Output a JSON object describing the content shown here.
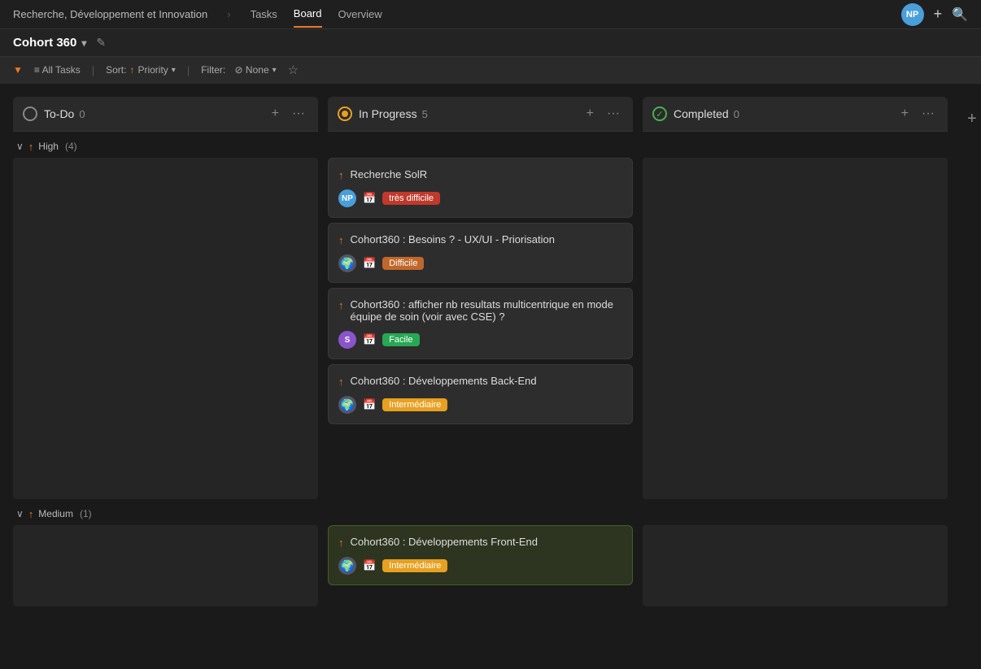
{
  "nav": {
    "breadcrumb": "Recherche, Développement et Innovation",
    "tabs": [
      "Tasks",
      "Board",
      "Overview"
    ],
    "active_tab": "Board",
    "top_right": {
      "avatar": "NP",
      "plus": "+",
      "search": "🔍"
    }
  },
  "toolbar": {
    "project_name": "Cohort 360",
    "dropdown_arrow": "▾",
    "edit_icon": "✎"
  },
  "filters": {
    "filter_label": "▼",
    "all_tasks": "≡ All Tasks",
    "sort_label": "Sort:",
    "sort_icon": "↑",
    "sort_value": "Priority",
    "filter_label2": "Filter:",
    "filter_none": "⊘ None",
    "star": "☆"
  },
  "columns": [
    {
      "id": "todo",
      "title": "To-Do",
      "count": 0,
      "status_type": "empty"
    },
    {
      "id": "inprogress",
      "title": "In Progress",
      "count": 5,
      "status_type": "progress"
    },
    {
      "id": "completed",
      "title": "Completed",
      "count": 0,
      "status_type": "done"
    }
  ],
  "groups": [
    {
      "id": "high",
      "label": "High",
      "count": 4,
      "cards": {
        "todo": [],
        "inprogress": [
          {
            "title": "Recherche SolR",
            "avatar": {
              "text": "NP",
              "color": "#4a9eda"
            },
            "tag": "très difficile",
            "tag_color": "tag-red"
          },
          {
            "title": "Cohort360 : Besoins ? - UX/UI - Priorisation",
            "avatar": {
              "text": "🌍",
              "color": "#556"
            },
            "tag": "Difficile",
            "tag_color": "tag-orange"
          },
          {
            "title": "Cohort360 : afficher nb resultats multicentrique en mode équipe de soin (voir avec CSE) ?",
            "avatar": {
              "text": "S",
              "color": "#8a55cc"
            },
            "tag": "Facile",
            "tag_color": "tag-green"
          },
          {
            "title": "Cohort360 : Développements Back-End",
            "avatar": {
              "text": "🌍",
              "color": "#556"
            },
            "tag": "Intermédiaire",
            "tag_color": "tag-yellow"
          }
        ],
        "completed": []
      }
    },
    {
      "id": "medium",
      "label": "Medium",
      "count": 1,
      "cards": {
        "todo": [],
        "inprogress": [
          {
            "title": "Cohort360 : Développements Front-End",
            "avatar": {
              "text": "🌍",
              "color": "#556"
            },
            "tag": "Intermédiaire",
            "tag_color": "tag-yellow",
            "highlighted": true
          }
        ],
        "completed": []
      }
    }
  ]
}
